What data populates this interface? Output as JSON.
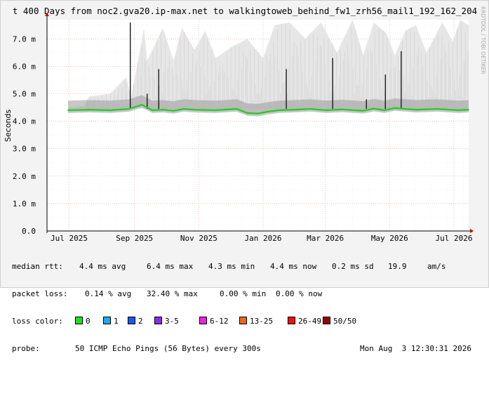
{
  "chart_data": {
    "type": "line",
    "title": "t 400 Days from noc2.gva20.ip-max.net to walkingtoweb_behind_fw1_zrh56_mail1_192_162_204",
    "ylabel": "Seconds",
    "watermark": "RRDTOOL / TOBI OETIKER",
    "ylim": [
      0,
      7.7
    ],
    "y_ticks": [
      "0.0",
      "1.0 m",
      "2.0 m",
      "3.0 m",
      "4.0 m",
      "5.0 m",
      "6.0 m",
      "7.0 m"
    ],
    "y_tick_values": [
      0,
      1,
      2,
      3,
      4,
      5,
      6,
      7
    ],
    "x_ticks": [
      "Jul 2025",
      "Sep 2025",
      "Nov 2025",
      "Jan 2026",
      "Mar 2026",
      "May 2026",
      "Jul 2026"
    ],
    "x_tick_days": [
      21,
      83,
      144,
      205,
      264,
      325,
      386
    ],
    "x_range_days": [
      0,
      400
    ],
    "data_start_day": 20,
    "y_unit": "ms",
    "grid": true,
    "series": [
      {
        "name": "median rtt",
        "color": "#22cc22",
        "x_days": [
          20,
          40,
          60,
          78,
          90,
          100,
          110,
          120,
          130,
          140,
          160,
          180,
          190,
          200,
          210,
          220,
          235,
          250,
          265,
          280,
          300,
          310,
          320,
          330,
          350,
          370,
          390,
          400
        ],
        "values": [
          4.4,
          4.42,
          4.4,
          4.45,
          4.6,
          4.4,
          4.42,
          4.38,
          4.45,
          4.42,
          4.4,
          4.45,
          4.3,
          4.28,
          4.35,
          4.4,
          4.42,
          4.45,
          4.4,
          4.43,
          4.38,
          4.46,
          4.4,
          4.48,
          4.42,
          4.45,
          4.4,
          4.42
        ]
      }
    ],
    "spikes": {
      "x_days": [
        79,
        95,
        106,
        227,
        271,
        303,
        321,
        336
      ],
      "values": [
        7.6,
        5.0,
        5.9,
        5.9,
        6.3,
        4.8,
        5.7,
        6.55
      ]
    },
    "max_envelope": {
      "x_days": [
        20,
        35,
        40,
        60,
        75,
        80,
        92,
        95,
        110,
        120,
        128,
        140,
        150,
        160,
        175,
        190,
        205,
        216,
        230,
        245,
        260,
        275,
        290,
        300,
        310,
        322,
        330,
        340,
        350,
        360,
        375,
        385,
        392,
        400
      ],
      "values": [
        4.5,
        4.55,
        4.9,
        5.0,
        5.6,
        4.9,
        7.4,
        6.2,
        7.4,
        6.2,
        7.4,
        6.6,
        7.3,
        6.3,
        6.7,
        7.0,
        6.3,
        7.5,
        7.6,
        7.0,
        7.6,
        6.5,
        7.7,
        6.4,
        7.6,
        7.2,
        6.4,
        7.3,
        7.5,
        6.5,
        7.6,
        6.9,
        7.7,
        7.5
      ]
    },
    "legend": {
      "median_line": "median rtt:",
      "median_stats": [
        "4.4 ms avg",
        "6.4 ms max",
        "4.3 ms min",
        "4.4 ms now",
        "0.2 ms sd",
        "19.9",
        "am/s"
      ],
      "loss_line": "packet loss:",
      "loss_stats": [
        "0.14 % avg",
        "32.40 % max",
        "0.00 % min",
        "0.00 % now"
      ],
      "loss_color_label": "loss color:",
      "loss_colors": [
        {
          "label": "0",
          "color": "#22dd22"
        },
        {
          "label": "1",
          "color": "#1ea8f0"
        },
        {
          "label": "2",
          "color": "#1c58ee"
        },
        {
          "label": "3-5",
          "color": "#8c2bf0"
        },
        {
          "label": "6-12",
          "color": "#ee22dd"
        },
        {
          "label": "13-25",
          "color": "#ee6622"
        },
        {
          "label": "26-49",
          "color": "#ee1111"
        },
        {
          "label": "50/50",
          "color": "#990000"
        }
      ],
      "probe_label": "probe:",
      "probe_text": "50 ICMP Echo Pings (56 Bytes) every 300s",
      "timestamp": "Mon Aug  3 12:30:31 2026"
    }
  }
}
